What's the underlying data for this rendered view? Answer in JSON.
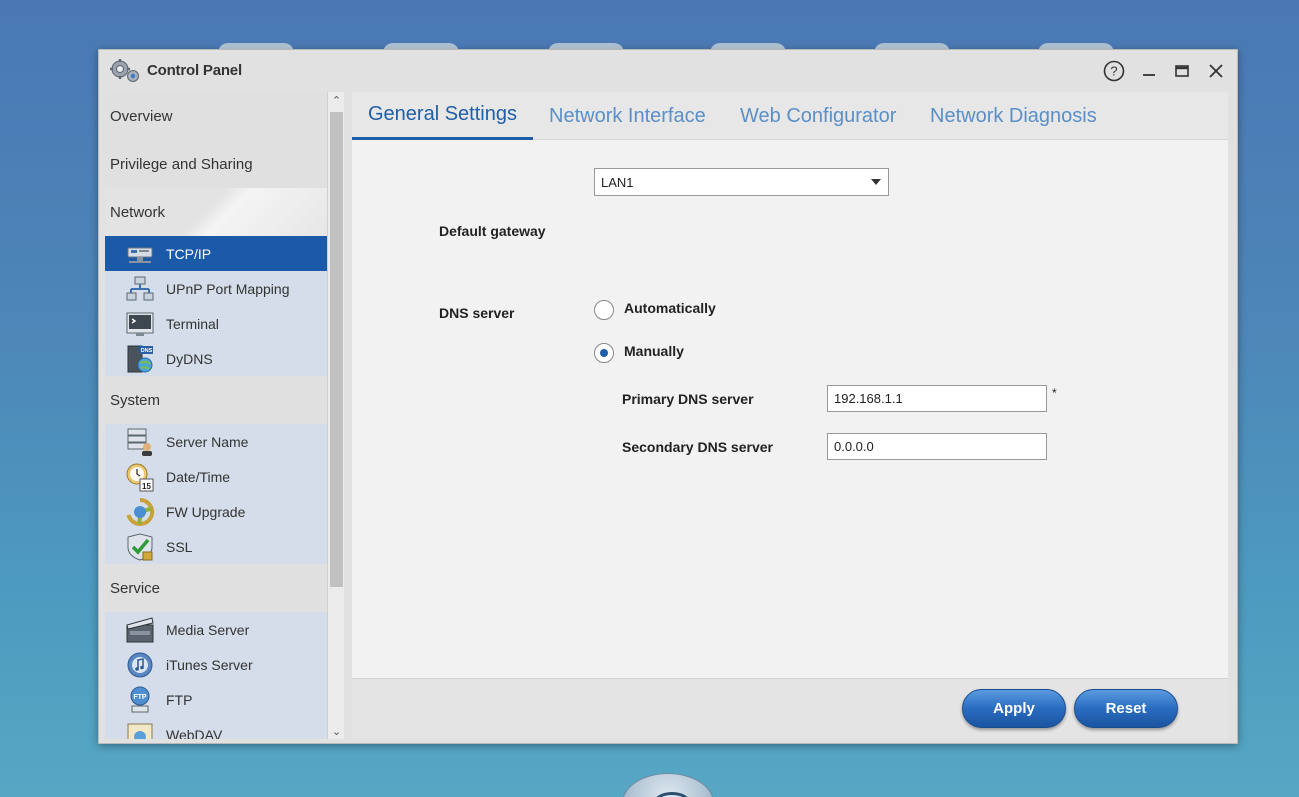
{
  "window": {
    "title": "Control Panel"
  },
  "titlebar_buttons": {
    "help": "help-icon",
    "minimize": "minimize-icon",
    "maximize": "maximize-icon",
    "close": "close-icon"
  },
  "sidebar": {
    "sections": [
      {
        "label": "Overview"
      },
      {
        "label": "Privilege and Sharing"
      },
      {
        "label": "Network",
        "items": [
          {
            "label": "TCP/IP",
            "icon": "network-card-icon",
            "selected": true
          },
          {
            "label": "UPnP Port Mapping",
            "icon": "port-mapping-icon"
          },
          {
            "label": "Terminal",
            "icon": "terminal-icon"
          },
          {
            "label": "DyDNS",
            "icon": "dydns-icon"
          }
        ]
      },
      {
        "label": "System",
        "items": [
          {
            "label": "Server Name",
            "icon": "server-name-icon"
          },
          {
            "label": "Date/Time",
            "icon": "date-time-icon"
          },
          {
            "label": "FW Upgrade",
            "icon": "fw-upgrade-icon"
          },
          {
            "label": "SSL",
            "icon": "ssl-icon"
          }
        ]
      },
      {
        "label": "Service",
        "items": [
          {
            "label": "Media Server",
            "icon": "media-server-icon"
          },
          {
            "label": "iTunes Server",
            "icon": "itunes-server-icon"
          },
          {
            "label": "FTP",
            "icon": "ftp-icon"
          },
          {
            "label": "WebDAV",
            "icon": "webdav-icon"
          }
        ]
      }
    ]
  },
  "tabs": [
    {
      "label": "General Settings",
      "active": true
    },
    {
      "label": "Network Interface"
    },
    {
      "label": "Web Configurator"
    },
    {
      "label": "Network Diagnosis"
    }
  ],
  "form": {
    "default_gateway_label": "Default gateway",
    "default_gateway_value": "LAN1",
    "dns_server_label": "DNS server",
    "dns_auto_label": "Automatically",
    "dns_manual_label": "Manually",
    "dns_mode": "Manually",
    "primary_dns_label": "Primary DNS server",
    "primary_dns_value": "192.168.1.1",
    "primary_dns_required": "*",
    "secondary_dns_label": "Secondary DNS server",
    "secondary_dns_value": "0.0.0.0"
  },
  "footer": {
    "apply_label": "Apply",
    "reset_label": "Reset"
  },
  "colors": {
    "accent": "#1f5ea8",
    "selected_item_bg": "#1a5aa8",
    "tab_inactive": "#5a8fc7"
  }
}
